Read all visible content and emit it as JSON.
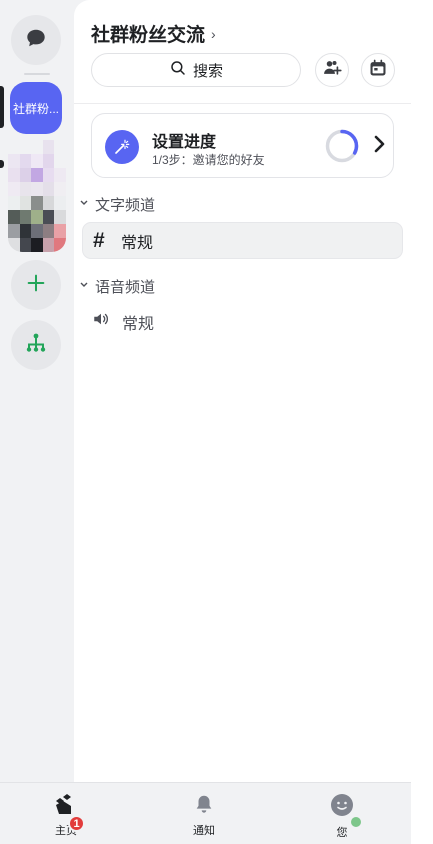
{
  "rail": {
    "dm_icon": "chat-bubble-icon",
    "active_server_label": "社群粉...",
    "add_icon": "plus-icon",
    "discover_icon": "hierarchy-icon"
  },
  "server": {
    "title": "社群粉丝交流",
    "title_chevron": "›"
  },
  "search": {
    "label": "搜索",
    "icon": "search-icon"
  },
  "header_icons": [
    "add-member-icon",
    "calendar-icon"
  ],
  "progress": {
    "title": "设置进度",
    "subtitle": "1/3步：邀请您的好友",
    "fraction": 0.33,
    "accent": "#5865f2"
  },
  "categories": [
    {
      "label": "文字频道",
      "channels": [
        {
          "name": "常规",
          "icon": "#",
          "selected": true
        }
      ]
    },
    {
      "label": "语音频道",
      "channels": [
        {
          "name": "常规",
          "icon": "speaker-icon",
          "selected": false
        }
      ]
    }
  ],
  "bottom_nav": {
    "home": {
      "label": "主页",
      "badge": "1"
    },
    "notifications": {
      "label": "通知"
    },
    "you": {
      "label": "您"
    }
  },
  "colors": {
    "brand": "#5865f2",
    "badge": "#e23c3c",
    "online": "#7dc68a",
    "add_green": "#23a55a"
  }
}
